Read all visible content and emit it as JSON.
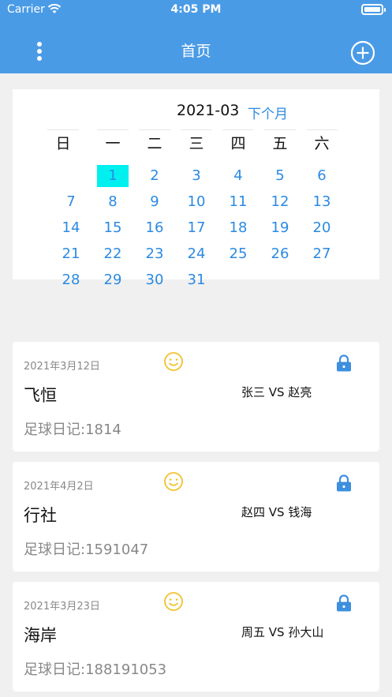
{
  "status_bar": {
    "carrier": "Carrier",
    "time": "4:05 PM"
  },
  "nav": {
    "title": "首页",
    "menu_icon": "more-vertical-icon",
    "add_icon": "plus-circle-icon"
  },
  "colors": {
    "primary": "#4a9be6",
    "link": "#2b8ae3",
    "selected_day": "#00f0f0",
    "smile": "#f2c12e"
  },
  "calendar": {
    "month": "2021-03",
    "next_label": "下个月",
    "weekdays": [
      "日",
      "一",
      "二",
      "三",
      "四",
      "五",
      "六"
    ],
    "days": [
      "1",
      "2",
      "3",
      "4",
      "5",
      "6",
      "7",
      "8",
      "9",
      "10",
      "11",
      "12",
      "13",
      "14",
      "15",
      "16",
      "17",
      "18",
      "19",
      "20",
      "21",
      "22",
      "23",
      "24",
      "25",
      "26",
      "27",
      "28",
      "29",
      "30",
      "31"
    ],
    "selected_day": "1"
  },
  "entries": [
    {
      "date": "2021年3月12日",
      "name": "飞恒",
      "match": "张三 VS 赵亮",
      "note": "足球日记:1814"
    },
    {
      "date": "2021年4月2日",
      "name": "行社",
      "match": "赵四 VS 钱海",
      "note": "足球日记:1591047"
    },
    {
      "date": "2021年3月23日",
      "name": "海岸",
      "match": "周五 VS 孙大山",
      "note": "足球日记:188191053"
    }
  ]
}
